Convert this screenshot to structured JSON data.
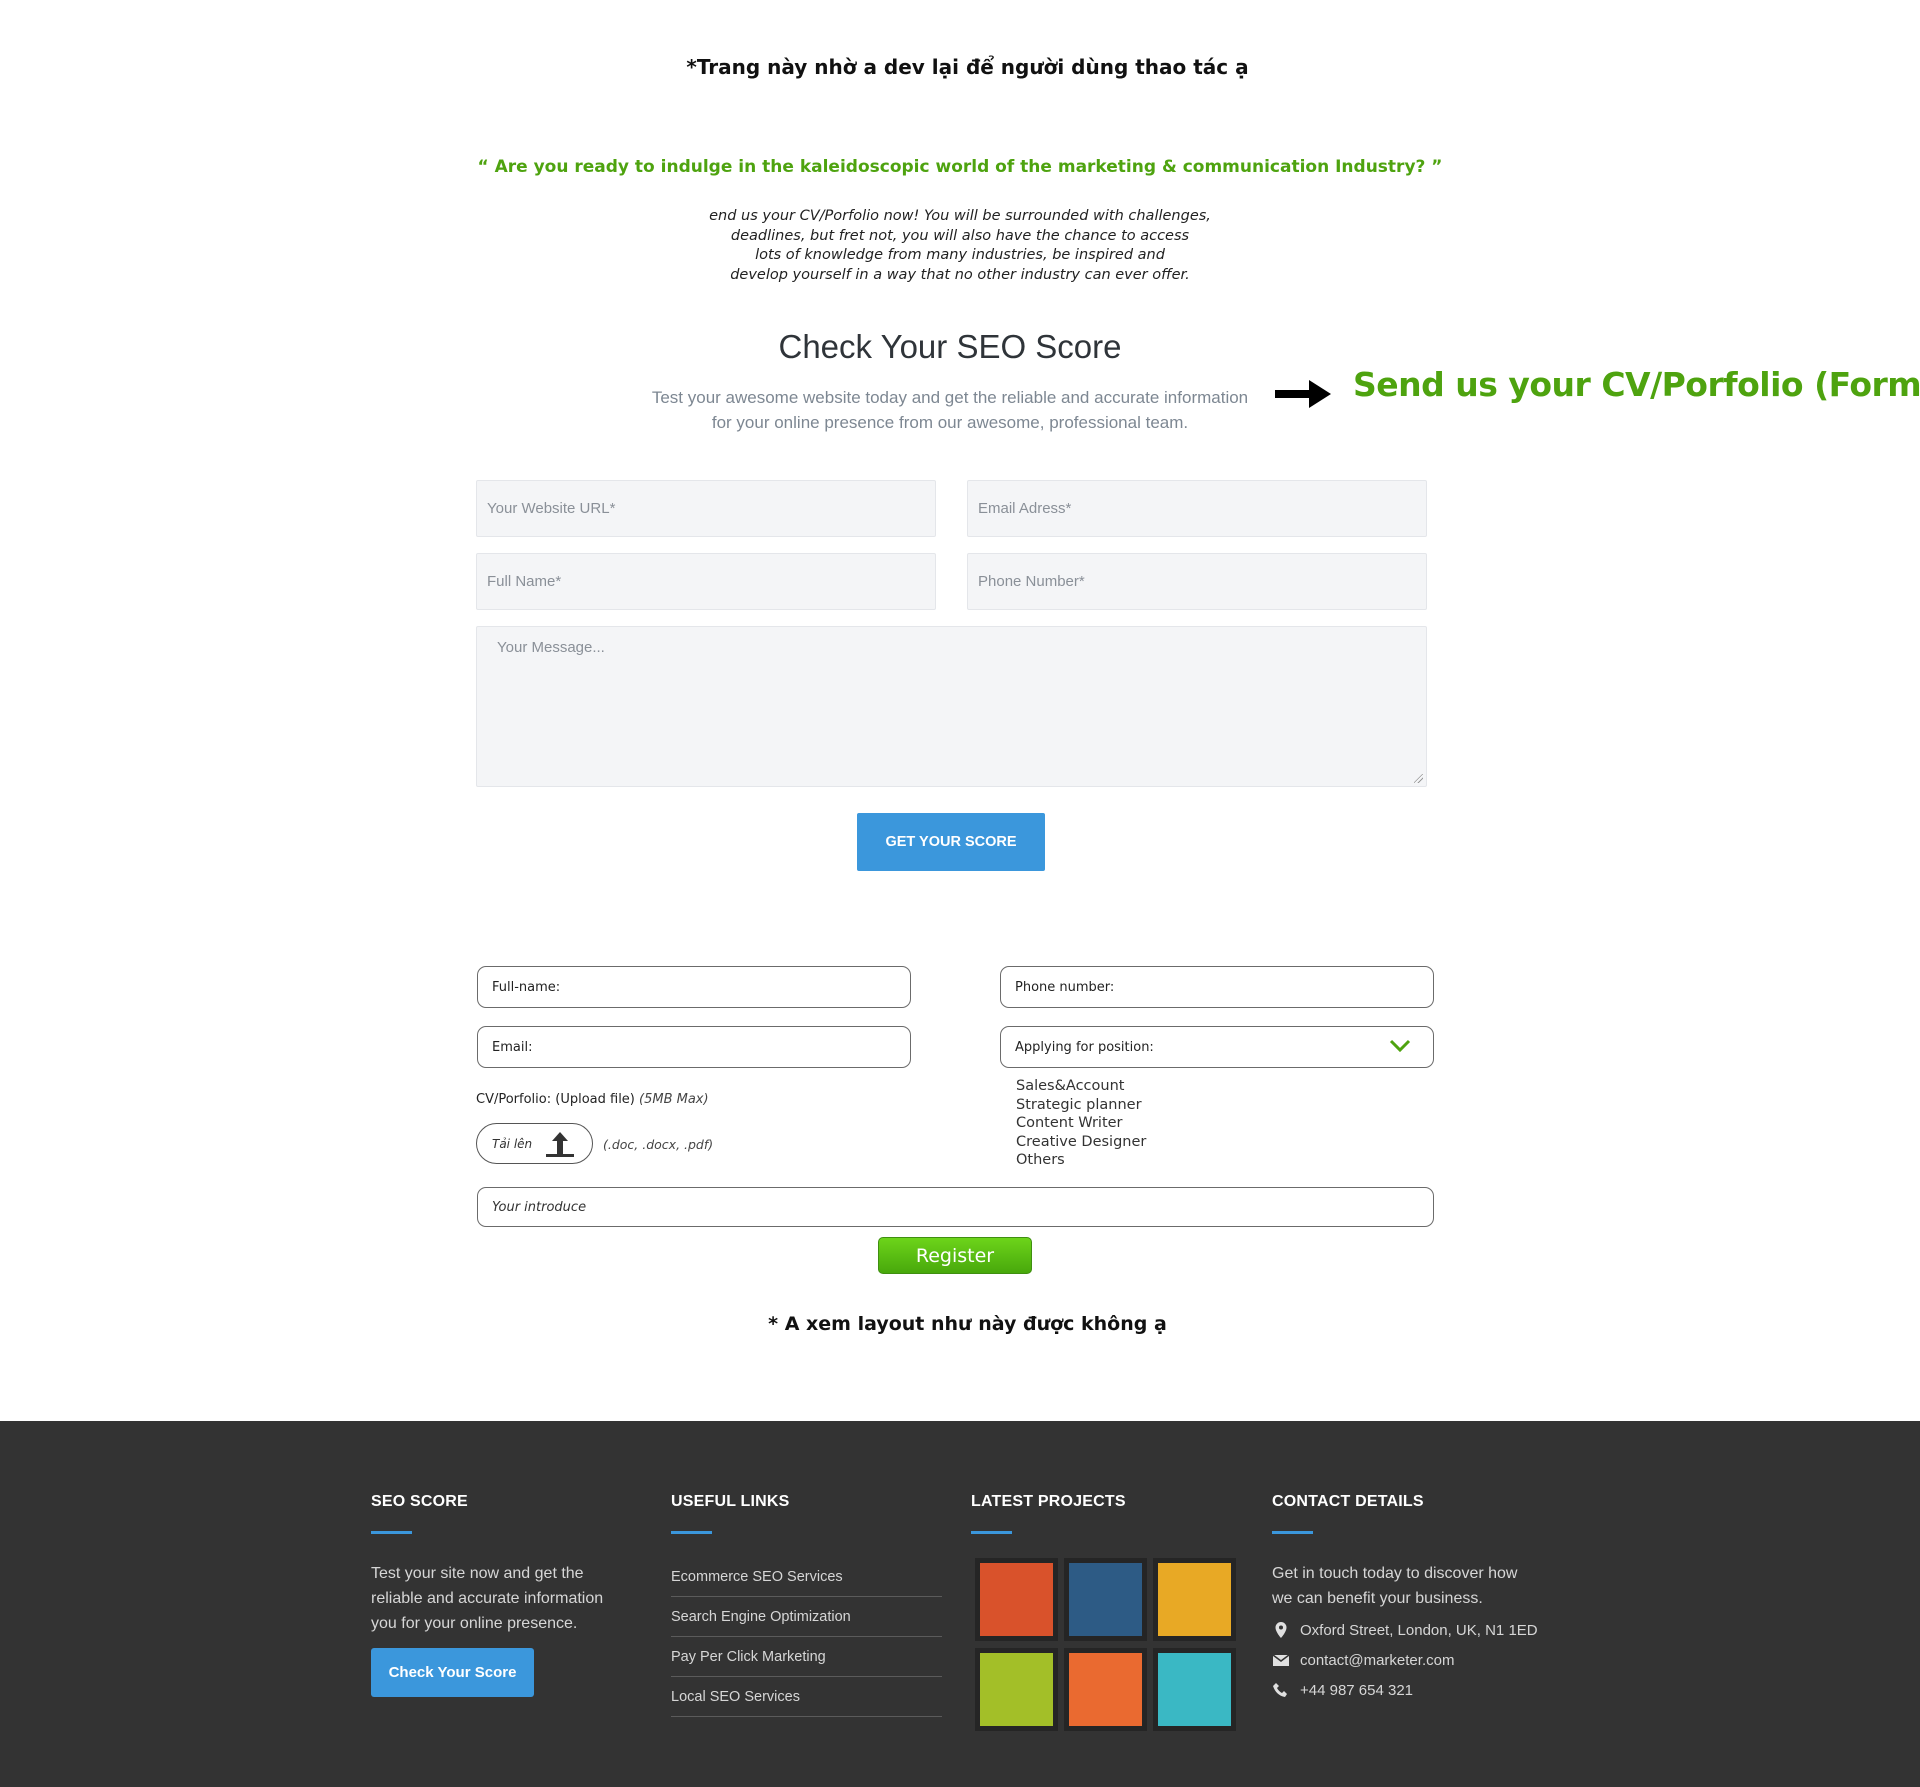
{
  "notes": {
    "top": "*Trang này nhờ a dev lại để người dùng thao tác ạ",
    "bottom": "* A xem layout như này được không ạ"
  },
  "hero": {
    "quote": "“ Are you ready to indulge in the kaleidoscopic world of the marketing & communication Industry? ”",
    "intro_lines": [
      "end us your CV/Porfolio now! You will be surrounded with challenges,",
      "deadlines, but fret not, you will also have the chance to access",
      "lots of knowledge from many industries, be inspired and",
      "develop yourself in a way that no other industry can ever offer."
    ]
  },
  "seo_form": {
    "title": "Check Your SEO Score",
    "subtitle_lines": [
      "Test your awesome website today and get the reliable and accurate information",
      "for your online presence from our awesome, professional team."
    ],
    "annotation": "Send us your CV/Porfolio (Form)",
    "fields": {
      "website": "Your Website URL*",
      "email": "Email Adress*",
      "fullname": "Full Name*",
      "phone": "Phone Number*",
      "message": "Your Message..."
    },
    "submit_label": "GET YOUR SCORE"
  },
  "cv_form": {
    "fullname": "Full-name:",
    "phone": "Phone number:",
    "email": "Email:",
    "position": "Applying for position:",
    "position_options": [
      "Sales&Account",
      "Strategic planner",
      "Content Writer",
      "Creative Designer",
      "Others"
    ],
    "cv_label": "CV/Porfolio: (Upload file)",
    "cv_max": "(5MB Max)",
    "upload_label": "Tải lên",
    "formats": "(.doc, .docx, .pdf)",
    "introduce": "Your introduce",
    "register_label": "Register"
  },
  "footer": {
    "seo": {
      "heading": "SEO SCORE",
      "text_lines": [
        "Test your site now and get the",
        "reliable and accurate information",
        "you for your online presence."
      ],
      "button": "Check Your Score"
    },
    "links": {
      "heading": "USEFUL LINKS",
      "items": [
        "Ecommerce SEO Services",
        "Search Engine Optimization",
        "Pay Per Click Marketing",
        "Local SEO Services"
      ]
    },
    "projects": {
      "heading": "LATEST PROJECTS",
      "colors": [
        "#d9522b",
        "#2d5b85",
        "#e8a925",
        "#a3bf28",
        "#ea6a30",
        "#3ab8c4"
      ]
    },
    "contact": {
      "heading": "CONTACT DETAILS",
      "text_lines": [
        "Get in touch today to discover how",
        "we can benefit your business."
      ],
      "address": "Oxford Street, London, UK, N1 1ED",
      "email": "contact@marketer.com",
      "phone": "+44 987 654 321"
    }
  }
}
